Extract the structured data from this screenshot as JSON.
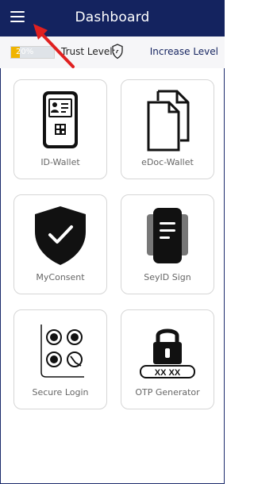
{
  "header": {
    "title": "Dashboard",
    "menu_icon": "hamburger-menu-icon"
  },
  "trust": {
    "progress_label": "20%",
    "progress_fraction": 0.2,
    "label": "Trust Level:",
    "increase_label": "Increase Level",
    "shield_icon": "shield-icon"
  },
  "tiles": [
    {
      "label": "ID-Wallet",
      "icon": "id-card-phone-icon"
    },
    {
      "label": "eDoc-Wallet",
      "icon": "documents-icon"
    },
    {
      "label": "MyConsent",
      "icon": "shield-check-icon"
    },
    {
      "label": "SeyID Sign",
      "icon": "sign-document-icon"
    },
    {
      "label": "Secure Login",
      "icon": "pattern-lock-icon"
    },
    {
      "label": "OTP Generator",
      "icon": "otp-lock-icon"
    }
  ],
  "colors": {
    "header": "#14235f",
    "progress": "#f0b400",
    "annotation_arrow": "#e02020"
  }
}
